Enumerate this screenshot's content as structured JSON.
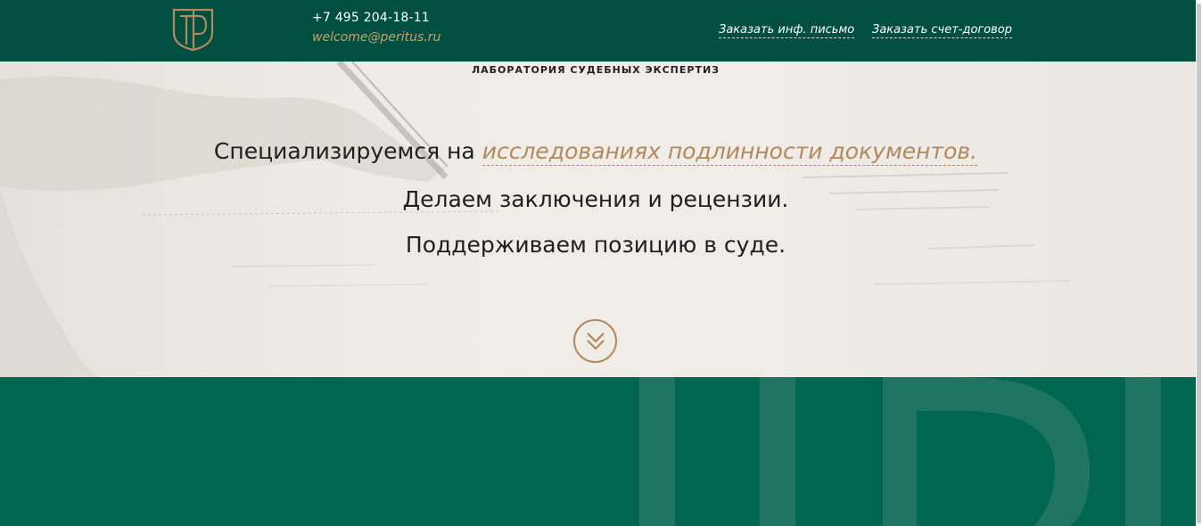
{
  "header": {
    "phone": "+7 495 204-18-11",
    "email": "welcome@peritus.ru",
    "links": {
      "info_letter": "Заказать инф. письмо",
      "invoice": "Заказать счет-договор"
    },
    "logo_icon": "tp-monogram-logo"
  },
  "hero": {
    "lab_title": "ЛАБОРАТОРИЯ СУДЕБНЫХ ЭКСПЕРТИЗ",
    "line1_prefix": "Специализируемся на",
    "line1_highlight": "исследованиях подлинности документов.",
    "line2": "Делаем заключения и рецензии.",
    "line3": "Поддерживаем позицию в суде.",
    "scroll_icon": "double-chevron-down-icon"
  },
  "colors": {
    "header_bg": "#004f40",
    "accent_gold": "#b08a5c",
    "lower_bg": "#00664f",
    "hero_bg": "#efeae4"
  }
}
